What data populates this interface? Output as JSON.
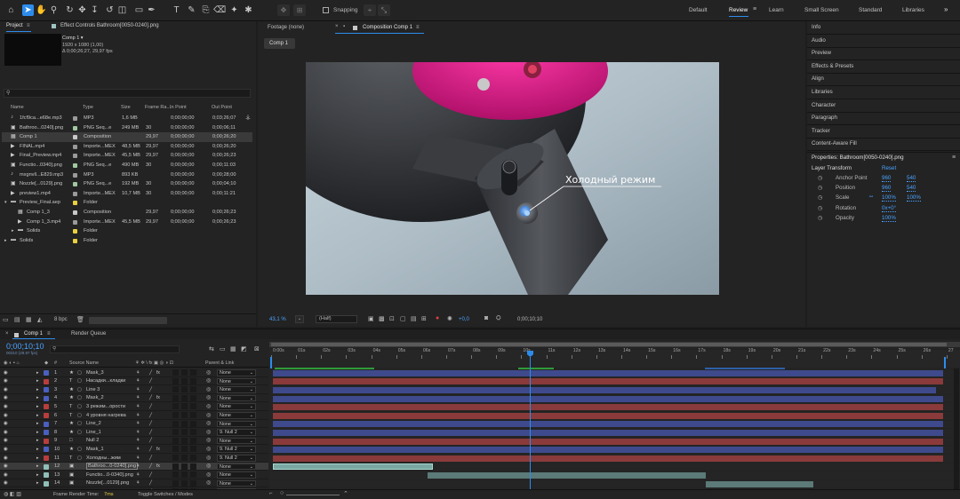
{
  "toolbar": {
    "tools": [
      "home-icon",
      "selection-icon",
      "hand-icon",
      "zoom-icon",
      "orbit-icon",
      "pan-icon",
      "dolly-icon",
      "rotate-icon",
      "camera-icon",
      "rectangle-icon",
      "pen-icon",
      "type-icon",
      "brush-icon",
      "clone-icon",
      "eraser-icon",
      "roto-icon",
      "puppet-icon"
    ],
    "snapping_label": "Snapping",
    "workspaces": [
      "Default",
      "Review",
      "Learn",
      "Small Screen",
      "Standard",
      "Libraries"
    ],
    "active_workspace": "Review",
    "more": "»"
  },
  "project": {
    "tab": "Project",
    "tab_menu": "≡",
    "effect_controls_tab": "Effect Controls Bathroom[0050-0240].png",
    "selected_name": "Comp 1 ▾",
    "selected_dims": "1920 x 1080 (1,00)",
    "selected_duration": "Δ 0;00;26;27, 29,97 fps",
    "search_placeholder": "",
    "headers": [
      "Name",
      "Type",
      "Size",
      "Frame Ra...",
      "In Point",
      "Out Point"
    ],
    "rows": [
      {
        "indent": 0,
        "icon": "audio-file-icon",
        "name": "1fcf9ca...e68e.mp3",
        "label": "#9a9a9a",
        "type": "MP3",
        "size": "1,6 MB",
        "fps": "",
        "in": "0;00;00;00",
        "out": "0;03;26;07"
      },
      {
        "indent": 0,
        "icon": "image-sequence-icon",
        "name": "Bathroo...0240].png",
        "label": "#a0c8a0",
        "type": "PNG Seq...e",
        "size": "249 MB",
        "fps": "30",
        "in": "0;00;00;00",
        "out": "0;00;06;11"
      },
      {
        "indent": 0,
        "icon": "composition-icon",
        "name": "Comp 1",
        "label": "#c8c8c8",
        "type": "Composition",
        "size": "",
        "fps": "29,97",
        "in": "0;00;00;00",
        "out": "0;00;26;20",
        "selected": true
      },
      {
        "indent": 0,
        "icon": "video-file-icon",
        "name": "FINAL.mp4",
        "label": "#9a9a9a",
        "type": "Importe...MEX",
        "size": "48,5 MB",
        "fps": "29,97",
        "in": "0;00;00;00",
        "out": "0;00;26;20"
      },
      {
        "indent": 0,
        "icon": "video-file-icon",
        "name": "Final_Preview.mp4",
        "label": "#9a9a9a",
        "type": "Importe...MEX",
        "size": "45,5 MB",
        "fps": "29,97",
        "in": "0;00;00;00",
        "out": "0;00;26;23"
      },
      {
        "indent": 0,
        "icon": "image-sequence-icon",
        "name": "Functio...0340].png",
        "label": "#a0c8a0",
        "type": "PNG Seq...e",
        "size": "490 MB",
        "fps": "30",
        "in": "0;00;00;00",
        "out": "0;00;11:03"
      },
      {
        "indent": 0,
        "icon": "audio-file-icon",
        "name": "mxgnvll...E829.mp3",
        "label": "#9a9a9a",
        "type": "MP3",
        "size": "893 KB",
        "fps": "",
        "in": "0;00;00;00",
        "out": "0;00;28;00"
      },
      {
        "indent": 0,
        "icon": "image-sequence-icon",
        "name": "Nozzle[...0129].png",
        "label": "#a0c8a0",
        "type": "PNG Seq...e",
        "size": "192 MB",
        "fps": "30",
        "in": "0;00;00;00",
        "out": "0;00;04;10"
      },
      {
        "indent": 0,
        "icon": "video-file-icon",
        "name": "preview1.mp4",
        "label": "#9a9a9a",
        "type": "Importe...MEX",
        "size": "10,7 MB",
        "fps": "30",
        "in": "0;00;00;00",
        "out": "0;00;11:21"
      },
      {
        "indent": 0,
        "icon": "folder-icon",
        "name": "Preview_Final.aep",
        "label": "#e8d040",
        "type": "Folder",
        "size": "",
        "fps": "",
        "in": "",
        "out": "",
        "expanded": true
      },
      {
        "indent": 1,
        "icon": "composition-icon",
        "name": "Comp 1_3",
        "label": "#c8c8c8",
        "type": "Composition",
        "size": "",
        "fps": "29,97",
        "in": "0;00;00;00",
        "out": "0;00;26;23"
      },
      {
        "indent": 1,
        "icon": "video-file-icon",
        "name": "Comp 1_3.mp4",
        "label": "#9a9a9a",
        "type": "Importe...MEX",
        "size": "45,5 MB",
        "fps": "29,97",
        "in": "0;00;00;00",
        "out": "0;00;26;23"
      },
      {
        "indent": 1,
        "icon": "folder-icon",
        "name": "Solids",
        "label": "#e8d040",
        "type": "Folder",
        "size": "",
        "fps": "",
        "in": "",
        "out": ""
      },
      {
        "indent": 0,
        "icon": "folder-icon",
        "name": "Solids",
        "label": "#e8d040",
        "type": "Folder",
        "size": "",
        "fps": "",
        "in": "",
        "out": ""
      }
    ],
    "bpc": "8 bpc"
  },
  "composition": {
    "footage_tab": "Footage (none)",
    "comp_tab": "Composition Comp 1",
    "comp_tab_menu": "≡",
    "breadcrumb": "Comp 1",
    "overlay_text": "Холодный режим",
    "zoom": "43,1 %",
    "resolution": "(Half)",
    "exposure": "+0,0",
    "timecode": "0;00;10;10"
  },
  "right_panels": [
    "Info",
    "Audio",
    "Preview",
    "Effects & Presets",
    "Align",
    "Libraries",
    "Character",
    "Paragraph",
    "Tracker",
    "Content-Aware Fill"
  ],
  "properties": {
    "title": "Properties: Bathroom[0050-0240].png",
    "section": "Layer Transform",
    "reset": "Reset",
    "items": [
      {
        "name": "Anchor Point",
        "v1": "960",
        "v2": "540"
      },
      {
        "name": "Position",
        "v1": "960",
        "v2": "540"
      },
      {
        "name": "Scale",
        "v1": "100%",
        "v2": "100%"
      },
      {
        "name": "Rotation",
        "v1": "0x+0°",
        "v2": ""
      },
      {
        "name": "Opacity",
        "v1": "100%",
        "v2": ""
      }
    ]
  },
  "timeline": {
    "tab": "Comp 1",
    "render_queue_tab": "Render Queue",
    "timecode": "0;00;10;10",
    "timecode_sub": "00310 (29.97 fps)",
    "search_placeholder": "",
    "headers": {
      "num": "#",
      "source": "Source Name",
      "parent": "Parent & Link"
    },
    "ruler": [
      "0:00s",
      "01s",
      "02s",
      "03s",
      "04s",
      "05s",
      "06s",
      "07s",
      "08s",
      "09s",
      "10s",
      "11s",
      "12s",
      "13s",
      "14s",
      "15s",
      "16s",
      "17s",
      "18s",
      "19s",
      "20s",
      "21s",
      "22s",
      "23s",
      "24s",
      "25s",
      "26s",
      "27"
    ],
    "playhead_seconds": 10.34,
    "duration_seconds": 26.9,
    "layers": [
      {
        "num": "1",
        "type": "★",
        "name": "Mask_3",
        "label": "#4a5fbf",
        "parent": "None",
        "bar": "#3e4a8c",
        "start": 0,
        "end": 26.8,
        "fx": true
      },
      {
        "num": "2",
        "type": "T",
        "name": "Насадки...кладки",
        "label": "#b83d3d",
        "parent": "None",
        "bar": "#8a3a3a",
        "start": 0,
        "end": 26.8
      },
      {
        "num": "3",
        "type": "★",
        "name": "Line 3",
        "label": "#4a5fbf",
        "parent": "None",
        "bar": "#3e4a8c",
        "start": 0,
        "end": 26.5
      },
      {
        "num": "4",
        "type": "★",
        "name": "Mask_2",
        "label": "#4a5fbf",
        "parent": "None",
        "bar": "#3e4a8c",
        "start": 0,
        "end": 26.8,
        "fx": true
      },
      {
        "num": "5",
        "type": "T",
        "name": "3 режим...орости",
        "label": "#b83d3d",
        "parent": "None",
        "bar": "#8a3a3a",
        "start": 0,
        "end": 26.8
      },
      {
        "num": "6",
        "type": "T",
        "name": "4 уровня нагрева",
        "label": "#b83d3d",
        "parent": "None",
        "bar": "#8a3a3a",
        "start": 0,
        "end": 26.8
      },
      {
        "num": "7",
        "type": "★",
        "name": "Line_2",
        "label": "#4a5fbf",
        "parent": "None",
        "bar": "#3e4a8c",
        "start": 0,
        "end": 26.8
      },
      {
        "num": "8",
        "type": "★",
        "name": "Line_1",
        "label": "#4a5fbf",
        "parent": "9. Null 2",
        "bar": "#3e4a8c",
        "start": 0,
        "end": 26.8
      },
      {
        "num": "9",
        "type": "□",
        "name": "Null 2",
        "label": "#b83d3d",
        "parent": "None",
        "bar": "#8a3a3a",
        "start": 0,
        "end": 26.8
      },
      {
        "num": "10",
        "type": "★",
        "name": "Mask_1",
        "label": "#4a5fbf",
        "parent": "9. Null 2",
        "bar": "#3e4a8c",
        "start": 0,
        "end": 26.8,
        "fx": true
      },
      {
        "num": "11",
        "type": "T",
        "name": "Холодны...жим",
        "label": "#b83d3d",
        "parent": "9. Null 2",
        "bar": "#8a3a3a",
        "start": 0,
        "end": 26.8
      },
      {
        "num": "12",
        "type": "▣",
        "name": "Bathroo...0-0240].png",
        "label": "#8fbfb8",
        "parent": "None",
        "bar": "#7aa9a3",
        "start": 0,
        "end": 6.4,
        "selected": true,
        "fx": true
      },
      {
        "num": "13",
        "type": "▣",
        "name": "Functio...0-0340].png",
        "label": "#8fbfb8",
        "parent": "None",
        "bar": "#5b7a78",
        "start": 6.2,
        "end": 17.3
      },
      {
        "num": "14",
        "type": "▣",
        "name": "Nozzle[...0129].png",
        "label": "#8fbfb8",
        "parent": "None",
        "bar": "#5b7a78",
        "start": 17.3,
        "end": 21.6
      },
      {
        "num": "15",
        "type": "▣",
        "name": "",
        "label": "#8fbfb8",
        "parent": "None",
        "bar": "#5b7a78",
        "start": 0,
        "end": 26.8
      }
    ],
    "frame_render_label": "Frame Render Time:",
    "frame_render_value": "7ms",
    "toggle_label": "Toggle Switches / Modes"
  }
}
